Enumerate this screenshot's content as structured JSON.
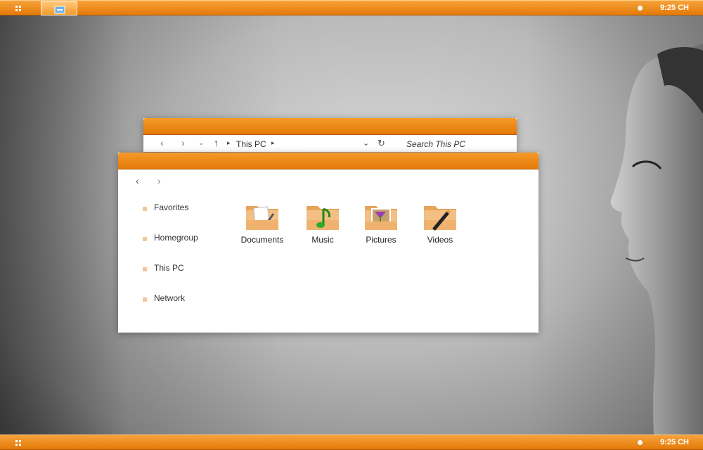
{
  "taskbar": {
    "clock": "9:25 CH"
  },
  "back_window": {
    "breadcrumb": "This PC",
    "search_placeholder": "Search This PC"
  },
  "front_window": {
    "sidebar": [
      {
        "label": "Favorites"
      },
      {
        "label": "Homegroup"
      },
      {
        "label": "This PC"
      },
      {
        "label": "Network"
      }
    ],
    "folders": [
      {
        "label": "Documents",
        "icon": "documents-icon"
      },
      {
        "label": "Music",
        "icon": "music-note-icon"
      },
      {
        "label": "Pictures",
        "icon": "pictures-icon"
      },
      {
        "label": "Videos",
        "icon": "videos-pencil-icon"
      }
    ]
  },
  "colors": {
    "accent_orange": "#e47a08",
    "accent_light": "#f6a23a",
    "sidebar_bullet": "#f0c89a"
  }
}
